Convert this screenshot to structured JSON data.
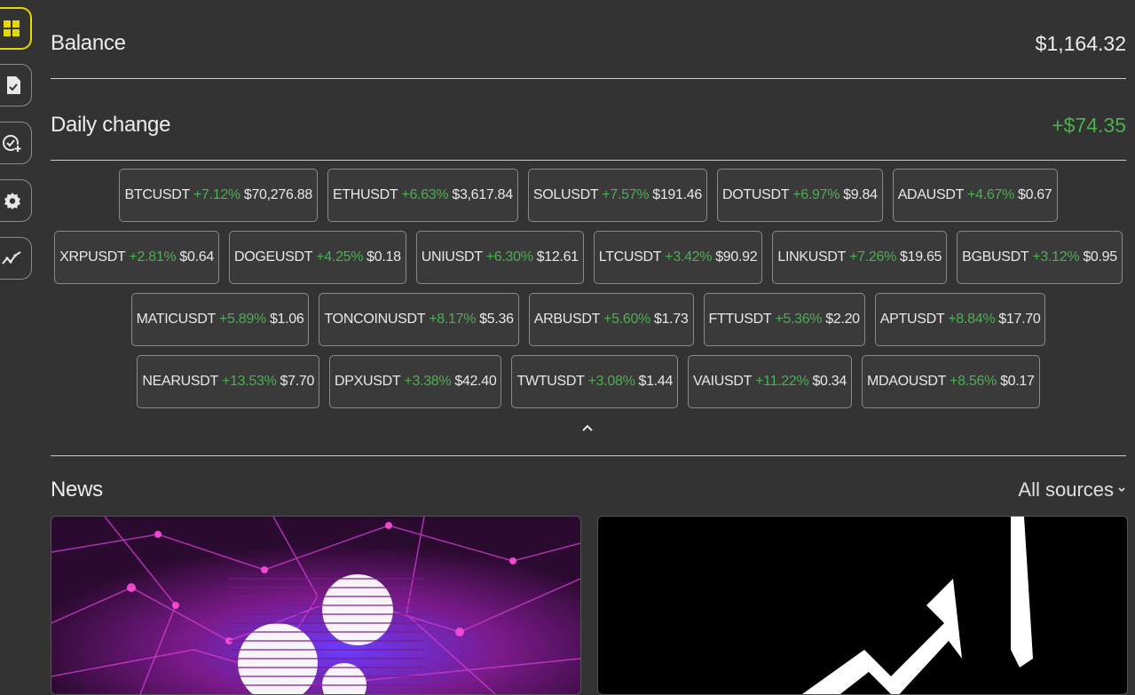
{
  "sidebar": {
    "items": [
      {
        "icon": "dashboard-grid-icon",
        "active": true
      },
      {
        "icon": "document-check-icon",
        "active": false
      },
      {
        "icon": "add-check-icon",
        "active": false
      },
      {
        "icon": "gear-icon",
        "active": false
      },
      {
        "icon": "trend-chart-icon",
        "active": false
      }
    ]
  },
  "balance": {
    "label": "Balance",
    "value": "$1,164.32"
  },
  "daily_change": {
    "label": "Daily change",
    "value": "+$74.35"
  },
  "tickers": [
    [
      {
        "symbol": "BTCUSDT",
        "change": "+7.12%",
        "price": "$70,276.88"
      },
      {
        "symbol": "ETHUSDT",
        "change": "+6.63%",
        "price": "$3,617.84"
      },
      {
        "symbol": "SOLUSDT",
        "change": "+7.57%",
        "price": "$191.46"
      },
      {
        "symbol": "DOTUSDT",
        "change": "+6.97%",
        "price": "$9.84"
      },
      {
        "symbol": "ADAUSDT",
        "change": "+4.67%",
        "price": "$0.67"
      }
    ],
    [
      {
        "symbol": "XRPUSDT",
        "change": "+2.81%",
        "price": "$0.64"
      },
      {
        "symbol": "DOGEUSDT",
        "change": "+4.25%",
        "price": "$0.18"
      },
      {
        "symbol": "UNIUSDT",
        "change": "+6.30%",
        "price": "$12.61"
      },
      {
        "symbol": "LTCUSDT",
        "change": "+3.42%",
        "price": "$90.92"
      },
      {
        "symbol": "LINKUSDT",
        "change": "+7.26%",
        "price": "$19.65"
      },
      {
        "symbol": "BGBUSDT",
        "change": "+3.12%",
        "price": "$0.95"
      }
    ],
    [
      {
        "symbol": "MATICUSDT",
        "change": "+5.89%",
        "price": "$1.06"
      },
      {
        "symbol": "TONCOINUSDT",
        "change": "+8.17%",
        "price": "$5.36"
      },
      {
        "symbol": "ARBUSDT",
        "change": "+5.60%",
        "price": "$1.73"
      },
      {
        "symbol": "FTTUSDT",
        "change": "+5.36%",
        "price": "$2.20"
      },
      {
        "symbol": "APTUSDT",
        "change": "+8.84%",
        "price": "$17.70"
      }
    ],
    [
      {
        "symbol": "NEARUSDT",
        "change": "+13.53%",
        "price": "$7.70"
      },
      {
        "symbol": "DPXUSDT",
        "change": "+3.38%",
        "price": "$42.40"
      },
      {
        "symbol": "TWTUSDT",
        "change": "+3.08%",
        "price": "$1.44"
      },
      {
        "symbol": "VAIUSDT",
        "change": "+11.22%",
        "price": "$0.34"
      },
      {
        "symbol": "MDAOUSDT",
        "change": "+8.56%",
        "price": "$0.17"
      }
    ]
  ],
  "news": {
    "title": "News",
    "filter_label": "All sources",
    "cards": [
      {
        "image": "xrp-logo-purple-network-image"
      },
      {
        "image": "white-arrow-up-black-image"
      }
    ]
  },
  "colors": {
    "background": "#333333",
    "positive": "#4caf50",
    "active_accent": "#e4d800"
  }
}
